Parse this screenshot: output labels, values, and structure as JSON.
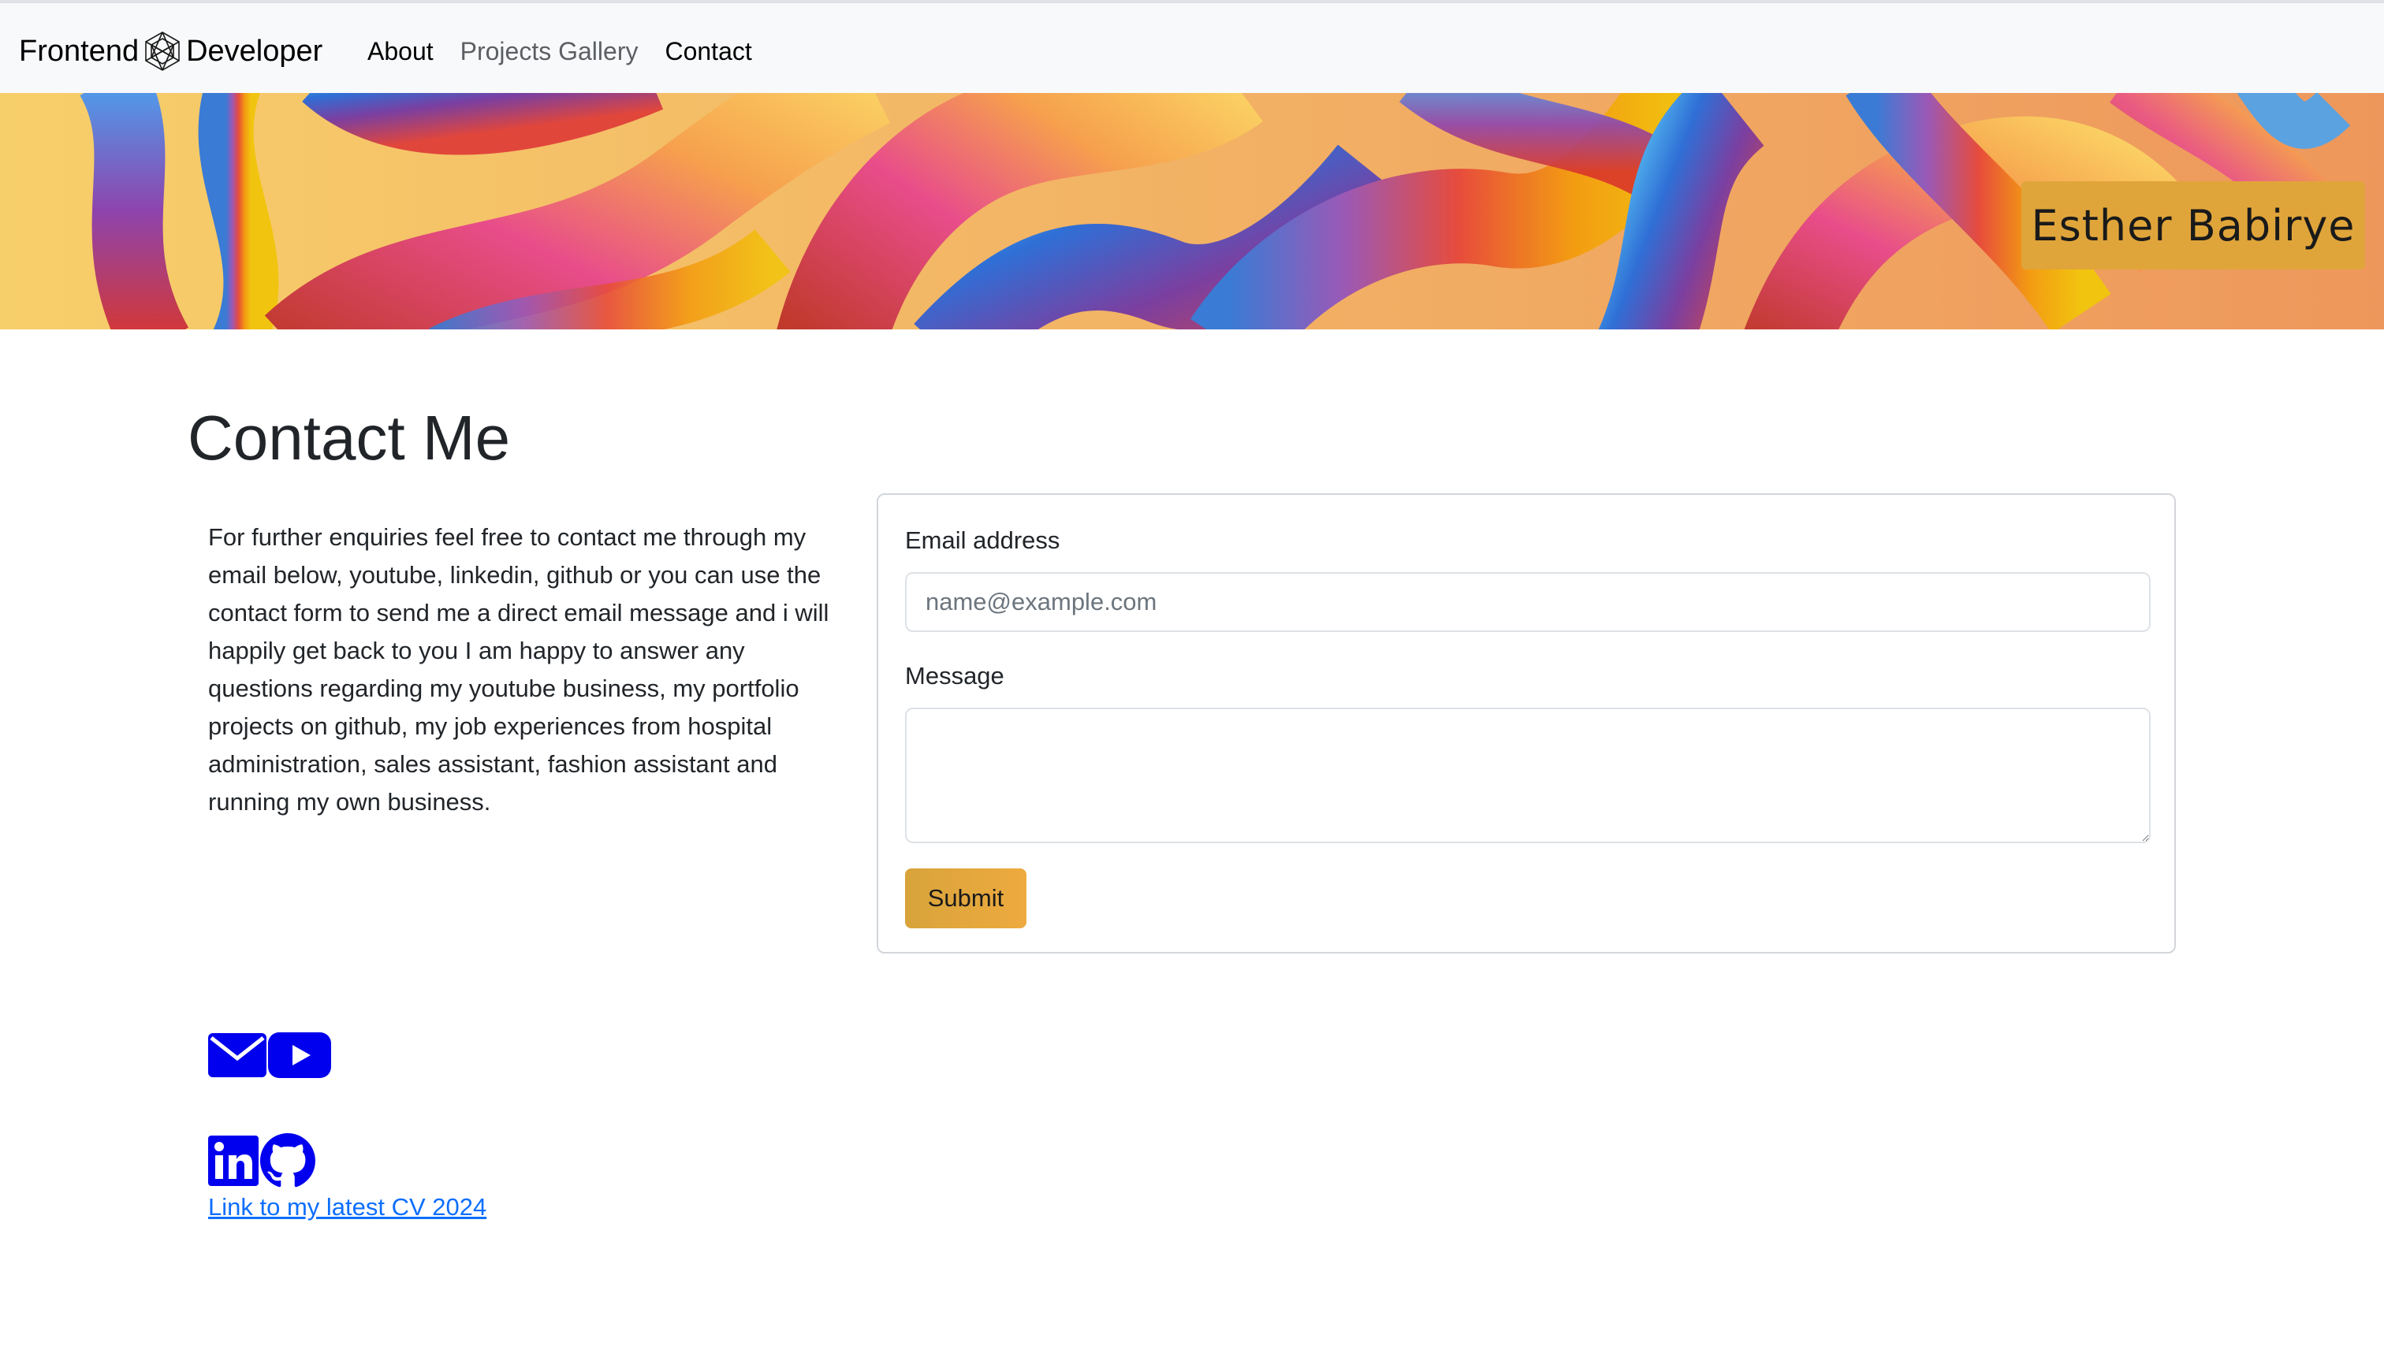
{
  "navbar": {
    "brand_left": "Frontend",
    "brand_right": "Developer",
    "brand_logo_icon": "hexagon-wireframe-logo-icon",
    "links": [
      {
        "label": "About",
        "active": false
      },
      {
        "label": "Projects Gallery",
        "active": true
      },
      {
        "label": "Contact",
        "active": false
      }
    ]
  },
  "hero": {
    "name": "Esther Babirye",
    "badge_color": "#e0a53a"
  },
  "main": {
    "title": "Contact Me",
    "intro": "For further enquiries feel free to contact me through my email below, youtube, linkedin, github or you can use the contact form to send me a direct email message and i will happily get back to you I am happy to answer any questions regarding my youtube business, my portfolio projects on github, my job experiences from hospital administration, sales assistant, fashion assistant and running my own business."
  },
  "contact_form": {
    "email_label": "Email address",
    "email_placeholder": "name@example.com",
    "email_value": "",
    "message_label": "Message",
    "message_value": "",
    "submit_label": "Submit",
    "submit_color": "#e5a83c"
  },
  "social": {
    "icon_color": "#0000ee",
    "icons": [
      "email-icon",
      "youtube-icon",
      "linkedin-icon",
      "github-icon"
    ]
  },
  "cv_link": {
    "label": "Link to my latest CV 2024",
    "color": "#0d6efd"
  }
}
